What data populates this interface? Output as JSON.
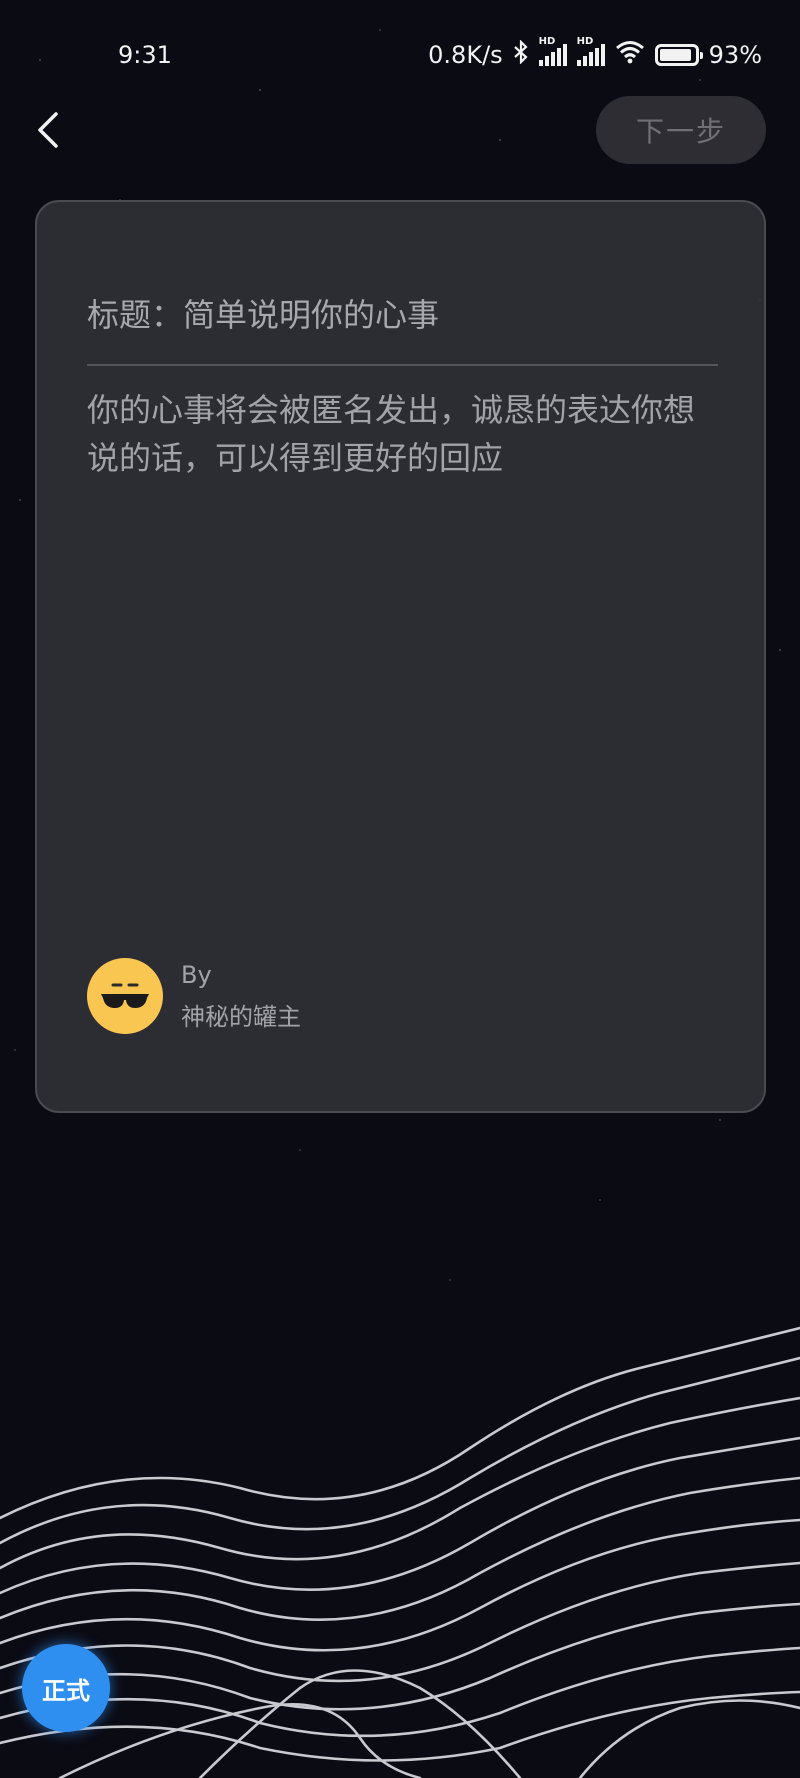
{
  "status_bar": {
    "time": "9:31",
    "network_speed": "0.8K/s",
    "sim1_label": "HD",
    "sim2_label": "HD",
    "battery": "93%",
    "battery_level": 0.93,
    "icons": [
      "bluetooth-icon",
      "signal-icon",
      "signal-icon",
      "wifi-icon",
      "battery-icon"
    ]
  },
  "header": {
    "back_icon": "chevron-left-icon",
    "next_label": "下一步"
  },
  "card": {
    "title_placeholder": "标题：简单说明你的心事",
    "body_placeholder": "你的心事将会被匿名发出，诚恳的表达你想说的话，可以得到更好的回应",
    "author_prefix": "By",
    "author_name": "神秘的罐主",
    "avatar_icon": "sunglasses-face-icon"
  },
  "env_badge": {
    "label": "正式",
    "color": "#2f8ff0"
  },
  "colors": {
    "background": "#0b0b14",
    "card": "#36363c",
    "avatar": "#f9c652"
  }
}
